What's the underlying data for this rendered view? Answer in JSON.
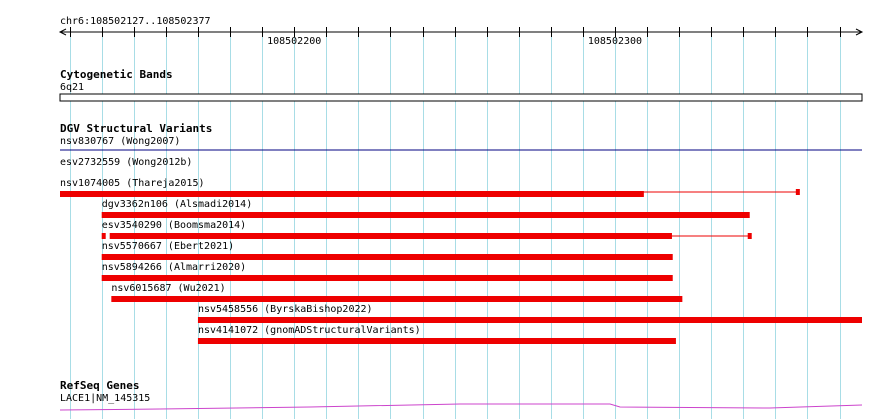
{
  "locus": "chr6:108502127..108502377",
  "ruler": {
    "start": 108502127,
    "end": 108502377,
    "labels": [
      {
        "text": "108502200",
        "pos": 108502200
      },
      {
        "text": "108502300",
        "pos": 108502300
      }
    ],
    "gridlines": [
      108502130,
      108502140,
      108502150,
      108502160,
      108502170,
      108502180,
      108502190,
      108502200,
      108502210,
      108502220,
      108502230,
      108502240,
      108502250,
      108502260,
      108502270,
      108502280,
      108502290,
      108502300,
      108502310,
      108502320,
      108502330,
      108502340,
      108502350,
      108502360,
      108502370
    ]
  },
  "tracks": {
    "cytoband": {
      "title": "Cytogenetic Bands",
      "band_label": "6q21"
    },
    "dgv": {
      "title": "DGV Structural Variants",
      "features": [
        {
          "label": "nsv830767 (Wong2007)",
          "start": 108502127,
          "end": 108502377,
          "style": "line",
          "color": "#000080"
        },
        {
          "label": "esv2732559 (Wong2012b)",
          "start": 108502127,
          "end": 108502357,
          "style": "line-end",
          "color": "#ee0000"
        },
        {
          "label": "nsv1074005 (Thareja2015)",
          "start": 108502127,
          "end": 108502309,
          "style": "bar",
          "color": "#ee0000"
        },
        {
          "label": "dgv3362n106 (Alsmadi2014)",
          "start": 108502140,
          "end": 108502342,
          "style": "bar",
          "color": "#ee0000"
        },
        {
          "label": "esv3540290 (Boomsma2014)",
          "start": 108502140,
          "end": 108502342,
          "style": "bar-gap",
          "color": "#ee0000"
        },
        {
          "label": "nsv5570667 (Ebert2021)",
          "start": 108502140,
          "end": 108502318,
          "style": "bar",
          "color": "#ee0000"
        },
        {
          "label": "nsv5894266 (Almarri2020)",
          "start": 108502140,
          "end": 108502318,
          "style": "bar",
          "color": "#ee0000"
        },
        {
          "label": "nsv6015687 (Wu2021)",
          "start": 108502143,
          "end": 108502321,
          "style": "bar",
          "color": "#ee0000"
        },
        {
          "label": "nsv5458556 (ByrskaBishop2022)",
          "start": 108502170,
          "end": 108502377,
          "style": "bar",
          "color": "#ee0000"
        },
        {
          "label": "nsv4141072 (gnomADStructuralVariants)",
          "start": 108502170,
          "end": 108502319,
          "style": "bar",
          "color": "#ee0000"
        }
      ]
    },
    "refseq": {
      "title": "RefSeq Genes",
      "gene_label": "LACE1|NM_145315",
      "color": "#cc44cc"
    }
  },
  "colors": {
    "grid": "#a8dde6",
    "variant": "#ee0000",
    "line_blue": "#000080",
    "intron": "#cc44cc"
  }
}
